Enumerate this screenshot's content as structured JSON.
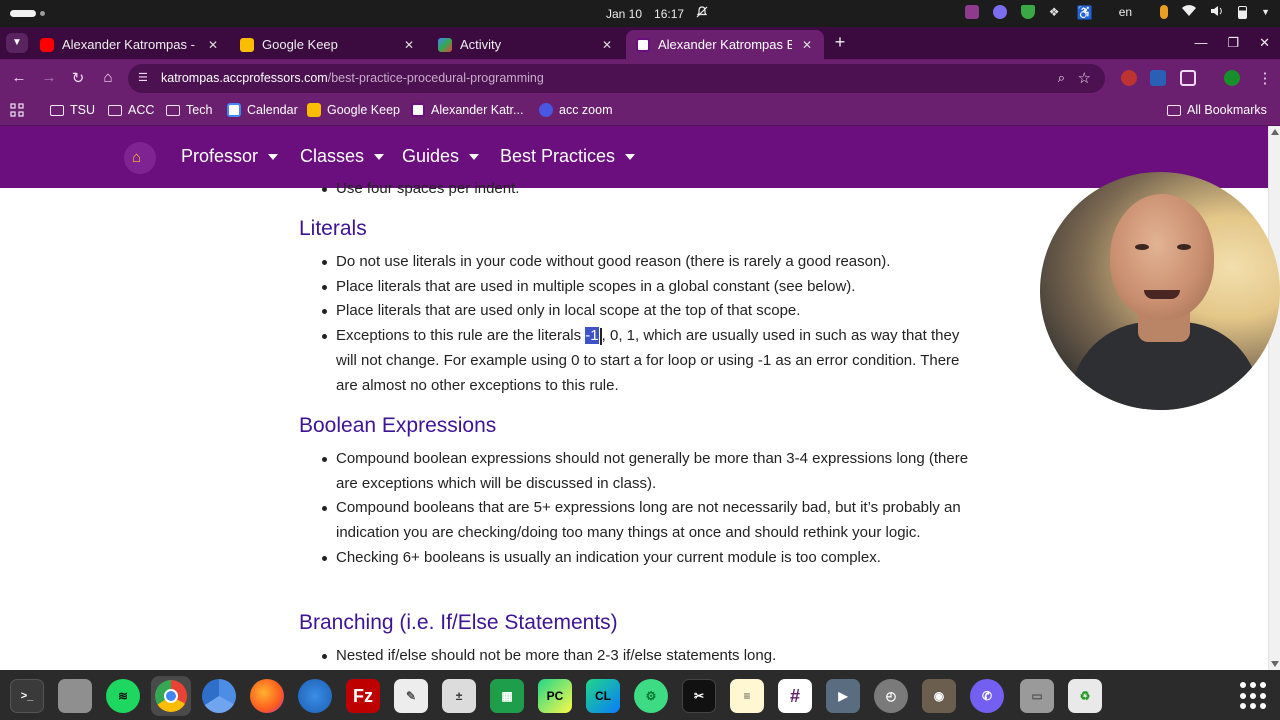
{
  "system_bar": {
    "date": "Jan 10",
    "time": "16:17",
    "language": "en"
  },
  "browser": {
    "tabs": [
      {
        "title": "Alexander Katrompas - Y",
        "favicon": "youtube-icon",
        "active": false
      },
      {
        "title": "Google Keep",
        "favicon": "google-keep-icon",
        "active": false
      },
      {
        "title": "Activity",
        "favicon": "activity-icon",
        "active": false
      },
      {
        "title": "Alexander Katrompas Be",
        "favicon": "katrompas-icon",
        "active": true
      }
    ],
    "url_host": "katrompas.accprofessors.com",
    "url_path": "/best-practice-procedural-programming",
    "bookmarks": [
      {
        "label": "TSU",
        "type": "folder"
      },
      {
        "label": "ACC",
        "type": "folder"
      },
      {
        "label": "Tech",
        "type": "folder"
      },
      {
        "label": "Calendar",
        "type": "link"
      },
      {
        "label": "Google Keep",
        "type": "link"
      },
      {
        "label": "Alexander Katr...",
        "type": "link"
      },
      {
        "label": "acc zoom",
        "type": "link"
      }
    ],
    "all_bookmarks_label": "All Bookmarks"
  },
  "site_nav": {
    "menus": [
      "Professor",
      "Classes",
      "Guides",
      "Best Practices"
    ]
  },
  "content": {
    "cut_item": "Use four spaces per indent.",
    "sections": [
      {
        "heading": "Literals",
        "items": [
          "Do not use literals in your code without good reason (there is rarely a good reason).",
          "Place literals that are used in multiple scopes in a global constant (see below).",
          "Place literals that are used only in local scope at the top of that scope."
        ],
        "exception_pre": "Exceptions to this rule are the literals ",
        "exception_sel": "-1",
        "exception_post": ", 0, 1, which are usually used in such as way that they will not change. For example using 0 to start a for loop or using -1 as an error condition. There are almost no other exceptions to this rule."
      },
      {
        "heading": "Boolean Expressions",
        "items": [
          "Compound boolean expressions should not generally be more than 3-4 expressions long (there are exceptions which will be discussed in class).",
          "Compound booleans that are 5+ expressions long are not necessarily bad, but it’s probably an indication you are checking/doing too many things at once and should rethink your logic.",
          "Checking 6+ booleans is usually an indication your current module is too complex."
        ]
      },
      {
        "heading": "Branching (i.e. If/Else Statements)",
        "items": [
          "Nested if/else should not be more than 2-3 if/else statements long."
        ]
      }
    ]
  },
  "dock": {
    "apps": [
      "terminal",
      "files",
      "spotify",
      "chrome",
      "chromium",
      "firefox",
      "thunderbird",
      "filezilla",
      "text-editor",
      "calculator",
      "spreadsheet",
      "pycharm",
      "clion",
      "android-studio",
      "capcut",
      "notes",
      "slack",
      "media-player",
      "clock",
      "gimp",
      "viber",
      "drive",
      "trash"
    ]
  },
  "colors": {
    "brand_purple": "#6b0f7f",
    "heading_color": "#3d1496",
    "home_icon": "#ffbf1f"
  }
}
